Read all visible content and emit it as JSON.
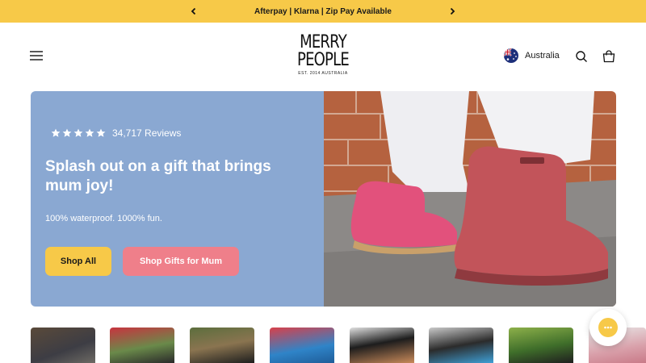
{
  "announcement": {
    "text": "Afterpay | Klarna | Zip Pay Available",
    "prev_icon": "chevron-left-icon",
    "next_icon": "chevron-right-icon"
  },
  "header": {
    "logo_line1": "MERRY",
    "logo_line2": "PEOPLE",
    "logo_tagline": "EST. 2014 AUSTRALIA",
    "country_label": "Australia",
    "icons": [
      "menu-icon",
      "australia-flag-icon",
      "search-icon",
      "bag-icon"
    ]
  },
  "hero": {
    "rating_stars": 5,
    "reviews_text": "34,717 Reviews",
    "headline": "Splash out on a gift that brings mum joy!",
    "subtext": "100% waterproof. 1000% fun.",
    "primary_button": "Shop All",
    "secondary_button": "Shop Gifts for Mum",
    "colors": {
      "panel": "#8aa8d2",
      "primary": "#f7c948",
      "secondary": "#ef7f8a"
    }
  },
  "thumbnails": {
    "count": 8
  },
  "chat": {
    "icon": "chat-bubble-icon"
  }
}
